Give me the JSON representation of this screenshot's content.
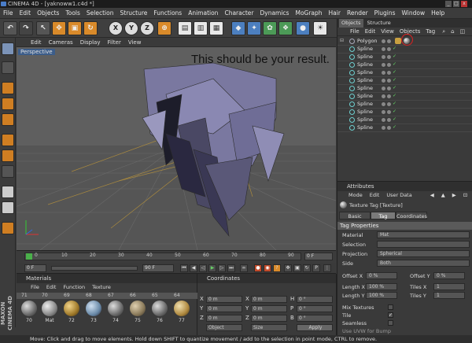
{
  "window": {
    "title": "CINEMA 4D - [yaknoww1.c4d *]",
    "controls": [
      "_",
      "□",
      "x"
    ]
  },
  "menubar": [
    "File",
    "Edit",
    "Objects",
    "Tools",
    "Selection",
    "Structure",
    "Functions",
    "Animation",
    "Character",
    "Dynamics",
    "MoGraph",
    "Hair",
    "Render",
    "Plugins",
    "Window",
    "Help"
  ],
  "viewport": {
    "menu": [
      "Edit",
      "Cameras",
      "Display",
      "Filter",
      "View"
    ],
    "label": "Perspective",
    "overlay_text": "This should be your result."
  },
  "timeline": {
    "ticks": [
      "0",
      "10",
      "20",
      "30",
      "40",
      "50",
      "60",
      "70",
      "80",
      "90"
    ],
    "current": "0 F"
  },
  "playbar": {
    "start": "0 F",
    "end": "90 F"
  },
  "materials": {
    "title": "Materials",
    "menu": [
      "File",
      "Edit",
      "Function",
      "Texture"
    ],
    "row_numbers": [
      "71",
      "70",
      "69",
      "68",
      "67",
      "66",
      "65",
      "64"
    ],
    "swatches": [
      "70",
      "Mat",
      "72",
      "73",
      "74",
      "75",
      "76",
      "77"
    ]
  },
  "coordinates": {
    "title": "Coordinates",
    "row_labels": [
      "X",
      "Y",
      "Z"
    ],
    "pos_values": [
      "0 m",
      "0 m",
      "0 m"
    ],
    "size_values": [
      "0 m",
      "0 m",
      "0 m"
    ],
    "rot_labels": [
      "H",
      "P",
      "B"
    ],
    "rot_values": [
      "0 °",
      "0 °",
      "0 °"
    ],
    "mode": "Object",
    "size_mode": "Size",
    "apply": "Apply"
  },
  "brand": "MAXON CINEMA 4D",
  "status": "Move: Click and drag to move elements. Hold down SHIFT to quantize movement / add to the selection in point mode, CTRL to remove.",
  "objects": {
    "tabs": [
      "Objects",
      "Structure"
    ],
    "menu": [
      "File",
      "Edit",
      "View",
      "Objects",
      "Tag"
    ],
    "rows": [
      "Polygon",
      "Spline",
      "Spline",
      "Spline",
      "Spline",
      "Spline",
      "Spline",
      "Spline",
      "Spline",
      "Spline",
      "Spline",
      "Spline"
    ]
  },
  "attributes": {
    "title": "Attributes",
    "menu": [
      "Mode",
      "Edit",
      "User Data"
    ],
    "object_name": "Texture Tag [Texture]",
    "tabs": [
      "Basic",
      "Tag",
      "Coordinates"
    ],
    "section": "Tag Properties",
    "material_label": "Material",
    "material_value": "Mat",
    "selection_label": "Selection",
    "projection_label": "Projection",
    "projection_value": "Spherical",
    "side_label": "Side",
    "side_value": "Both",
    "offset_x_label": "Offset X",
    "offset_x_value": "0 %",
    "offset_y_label": "Offset Y",
    "offset_y_value": "0 %",
    "length_x_label": "Length X",
    "length_x_value": "100 %",
    "length_y_label": "Length Y",
    "length_y_value": "100 %",
    "tiles_x_label": "Tiles X",
    "tiles_x_value": "1",
    "tiles_y_label": "Tiles Y",
    "tiles_y_value": "1",
    "mix_textures_label": "Mix Textures",
    "tile_label": "Tile",
    "seamless_label": "Seamless",
    "uvw_bump_label": "Use UVW for Bump"
  },
  "colors": {
    "accent": "#d98a2a",
    "selected_tab": "#3c5d8a",
    "highlight_circle": "#e02020"
  }
}
